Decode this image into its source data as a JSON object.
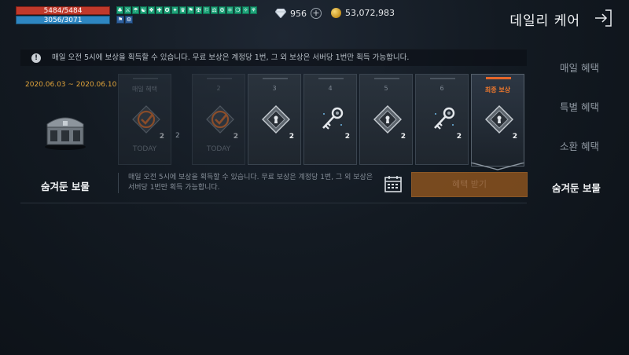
{
  "player": {
    "hp": "5484/5484",
    "mp": "3056/3071"
  },
  "buffs_row1": [
    "♣",
    "⚔",
    "☂",
    "☯",
    "❖",
    "✚",
    "✪",
    "✦",
    "♛",
    "⚑",
    "✠",
    "⚐",
    "⚖",
    "⚙",
    "⚛",
    "❍",
    "✧",
    "⚘"
  ],
  "buffs_row2": [
    "⚑",
    "⚙"
  ],
  "currency": {
    "gems": "956",
    "gold": "53,072,983"
  },
  "header": {
    "title": "데일리 케어"
  },
  "notice": {
    "icon": "alert-icon",
    "text": "매일 오전 5시에 보상을 획득할 수 있습니다. 무료 보상은 계정당 1번, 그 외 보상은 서버당 1번만 획득 가능합니다."
  },
  "side_tabs": [
    {
      "label": "매일 혜택"
    },
    {
      "label": "특별 혜택"
    },
    {
      "label": "소환 혜택"
    }
  ],
  "event": {
    "date_range": "2020.06.03 ~ 2020.06.10",
    "chest_name": "숨겨둔 보물",
    "chest_name_right": "숨겨둔 보물",
    "description": "매일 오전 5시에 보상을 획득할 수 있습니다. 무료 보상은 계정당 1번, 그 외 보상은 서버당 1번만 획득 가능합니다.",
    "claim_label": "혜택 받기"
  },
  "cards": [
    {
      "day": "매일 혜택",
      "item": "check-icon",
      "count": "2",
      "status": "TODAY",
      "claimed": true
    },
    {
      "day": "2",
      "item": "check-icon",
      "count": "2",
      "status": "TODAY",
      "claimed": true
    },
    {
      "day": "3",
      "item": "gem-icon",
      "count": "2",
      "status": "",
      "claimed": false
    },
    {
      "day": "4",
      "item": "key-icon",
      "count": "2",
      "status": "",
      "claimed": false
    },
    {
      "day": "5",
      "item": "gem-icon",
      "count": "2",
      "status": "",
      "claimed": false
    },
    {
      "day": "6",
      "item": "key-icon",
      "count": "2",
      "status": "",
      "claimed": false
    },
    {
      "day": "최종 보상",
      "item": "gem-icon",
      "count": "2",
      "status": "",
      "claimed": false,
      "final": true
    }
  ],
  "colors": {
    "accent": "#e7672a",
    "date": "#e0a33a",
    "claim": "#9a5a1e"
  }
}
